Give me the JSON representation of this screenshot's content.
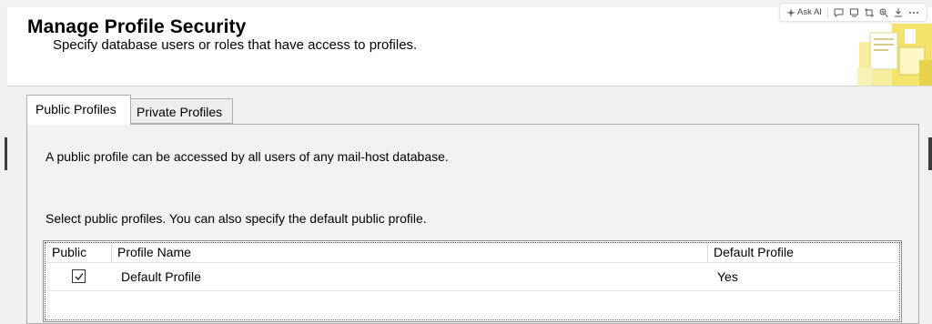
{
  "header": {
    "title": "Manage Profile Security",
    "subtitle": "Specify database users or roles that have access to profiles."
  },
  "toolbar": {
    "ask_ai_label": "Ask AI",
    "icons": [
      "sparkle-icon",
      "comment-icon",
      "monitor-icon",
      "crop-icon",
      "zoom-in-icon",
      "download-icon",
      "more-icon"
    ]
  },
  "tabs": [
    {
      "label": "Public Profiles",
      "selected": true
    },
    {
      "label": "Private Profiles",
      "selected": false
    }
  ],
  "panel": {
    "description": "A public profile can be accessed by all users of any mail-host database.",
    "instruction": "Select public profiles. You can also specify the default public profile."
  },
  "grid": {
    "columns": [
      "Public",
      "Profile Name",
      "Default Profile"
    ],
    "rows": [
      {
        "public": true,
        "profile_name": "Default Profile",
        "default_profile": "Yes"
      }
    ]
  },
  "colors": {
    "window_bg": "#f0f0f0",
    "header_bg": "#ffffff",
    "border": "#adadad",
    "accent_yellow": "#f5e86b"
  }
}
